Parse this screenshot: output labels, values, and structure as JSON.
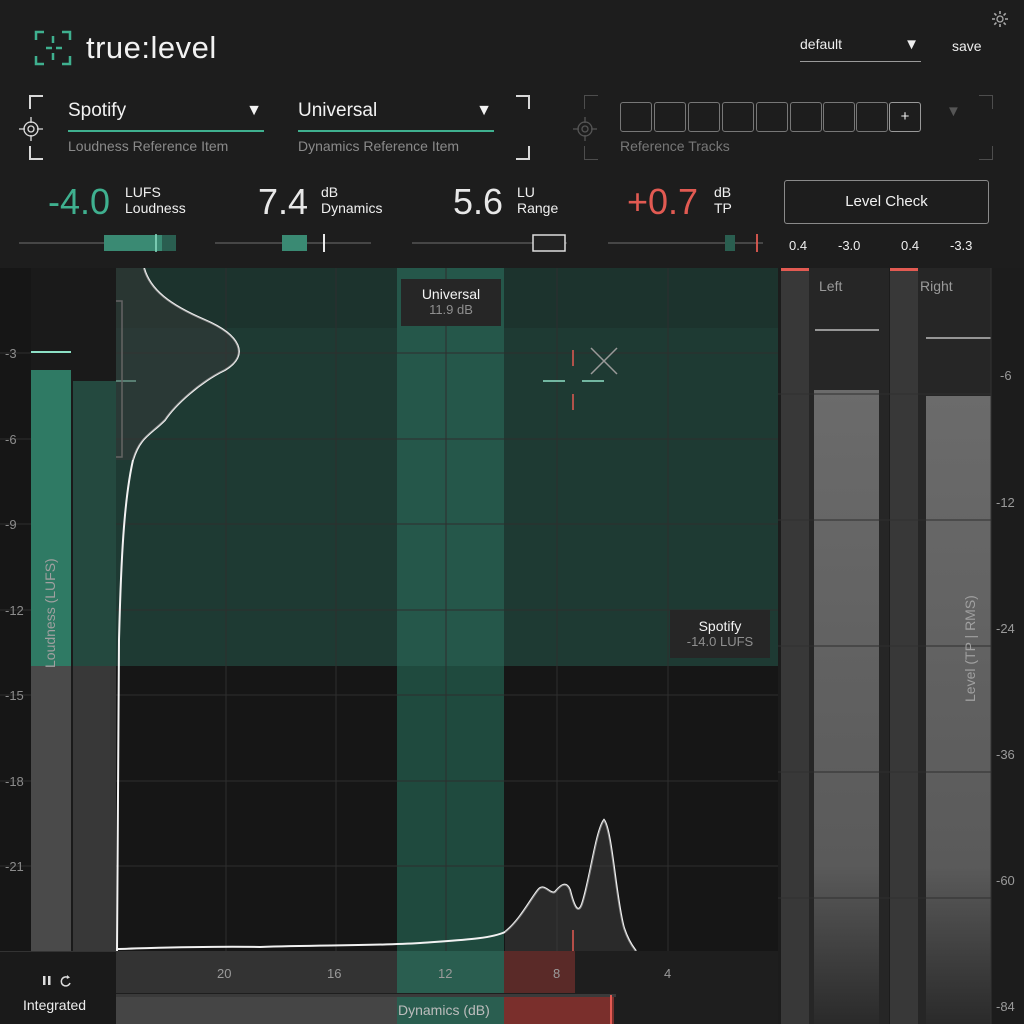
{
  "app": {
    "logo_text": "true:level",
    "accent": "#3fb08f",
    "warn": "#e25a52"
  },
  "header": {
    "preset_label": "default",
    "save_label": "save",
    "loudness_reference": {
      "value": "Spotify",
      "caption": "Loudness Reference Item"
    },
    "dynamics_reference": {
      "value": "Universal",
      "caption": "Dynamics Reference Item"
    },
    "reference_tracks": {
      "caption": "Reference Tracks",
      "slot_count": 8,
      "add_label": "+"
    }
  },
  "metrics": {
    "loudness": {
      "value": "-4.0",
      "unit": "LUFS",
      "name": "Loudness",
      "color": "#3fb08f"
    },
    "dynamics": {
      "value": "7.4",
      "unit": "dB",
      "name": "Dynamics",
      "color": "#f2f2f2"
    },
    "range": {
      "value": "5.6",
      "unit": "LU",
      "name": "Range",
      "color": "#f2f2f2"
    },
    "tp": {
      "value": "+0.7",
      "unit": "dB",
      "name": "TP",
      "color": "#e25a52"
    },
    "level_check_label": "Level Check",
    "channel_readouts": [
      "0.4",
      "-3.0",
      "0.4",
      "-3.3"
    ]
  },
  "plot": {
    "y_axis_label": "Loudness (LUFS)",
    "y_ticks": [
      "-3",
      "-6",
      "-9",
      "-12",
      "-15",
      "-18",
      "-21"
    ],
    "x_axis_label": "Dynamics (dB)",
    "x_ticks": [
      "20",
      "16",
      "12",
      "8",
      "4"
    ],
    "universal_tooltip": {
      "title": "Universal",
      "value": "11.9 dB"
    },
    "spotify_tooltip": {
      "title": "Spotify",
      "value": "-14.0 LUFS"
    }
  },
  "meters": {
    "left_label": "Left",
    "right_label": "Right",
    "axis_label": "Level (TP | RMS)",
    "scale_ticks": [
      "-6",
      "-12",
      "-24",
      "-36",
      "-60",
      "-84"
    ]
  },
  "mode": {
    "label": "Integrated",
    "pause_icon": "pause-icon",
    "reset_icon": "reset-icon"
  }
}
